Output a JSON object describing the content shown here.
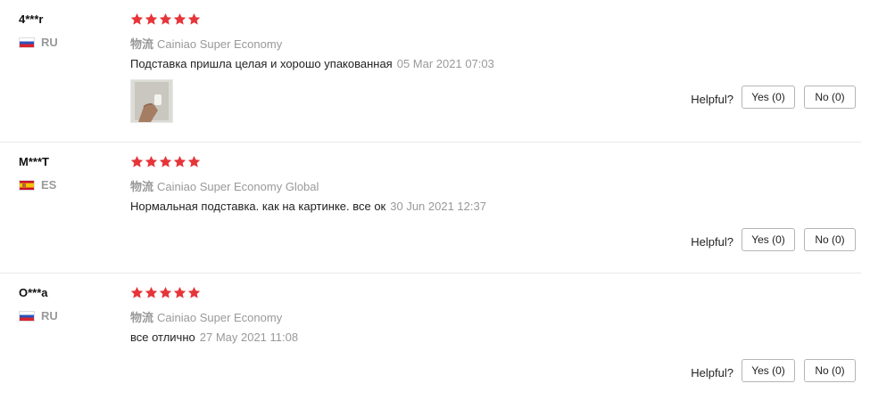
{
  "helpful_label": "Helpful?",
  "logistics_label": "物流",
  "star_color": "#e6353a",
  "reviews": [
    {
      "user": "4***r",
      "country": "RU",
      "flag_icon": "flag-russia",
      "rating": 5,
      "logistics": "Cainiao Super Economy",
      "text": "Подставка пришла целая и хорошо упакованная",
      "date": "05 Mar 2021 07:03",
      "has_photo": true,
      "yes_label": "Yes (0)",
      "no_label": "No (0)"
    },
    {
      "user": "M***T",
      "country": "ES",
      "flag_icon": "flag-spain",
      "rating": 5,
      "logistics": "Cainiao Super Economy Global",
      "text": "Нормальная подставка. как на картинке. все ок",
      "date": "30 Jun 2021 12:37",
      "has_photo": false,
      "yes_label": "Yes (0)",
      "no_label": "No (0)"
    },
    {
      "user": "O***a",
      "country": "RU",
      "flag_icon": "flag-russia",
      "rating": 5,
      "logistics": "Cainiao Super Economy",
      "text": "все отлично",
      "date": "27 May 2021 11:08",
      "has_photo": false,
      "yes_label": "Yes (0)",
      "no_label": "No (0)"
    }
  ]
}
